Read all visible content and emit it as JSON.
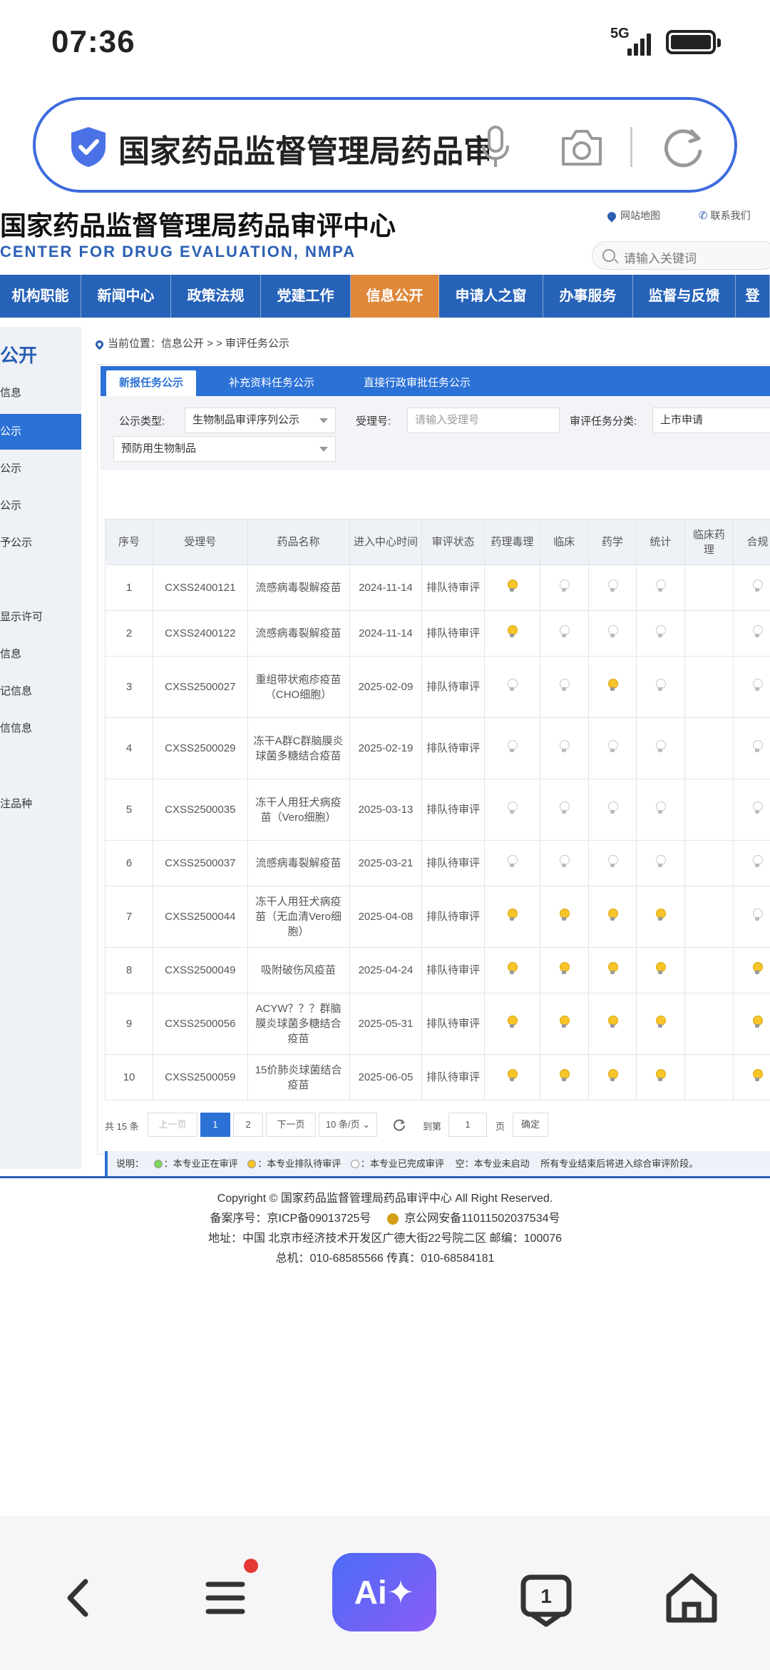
{
  "status": {
    "time": "07:36",
    "network": "5G"
  },
  "browser": {
    "search_text": "国家药品监督管理局药品审评中心"
  },
  "site": {
    "title_cn": "国家药品监督管理局药品审评中心",
    "title_en": "CENTER FOR DRUG EVALUATION, NMPA",
    "link_sitemap": "网站地图",
    "link_contact": "联系我们",
    "search_placeholder": "请输入关键词",
    "nav": [
      "机构职能",
      "新闻中心",
      "政策法规",
      "党建工作",
      "信息公开",
      "申请人之窗",
      "办事服务",
      "监督与反馈",
      "登"
    ],
    "nav_active": "信息公开"
  },
  "sidebar": {
    "title": "公开",
    "items": [
      "信息",
      "公示",
      "公示",
      "公示",
      "予公示",
      "显示许可",
      "信息",
      "记信息",
      "信信息",
      "注品种"
    ]
  },
  "breadcrumb": "当前位置：信息公开 > > 审评任务公示",
  "tabs": [
    "新报任务公示",
    "补充资料任务公示",
    "直接行政审批任务公示"
  ],
  "filters": {
    "type_label": "公示类型:",
    "type_value": "生物制品审评序列公示",
    "subtype_value": "预防用生物制品",
    "accept_label": "受理号:",
    "accept_placeholder": "请输入受理号",
    "task_label": "审评任务分类:",
    "task_value": "上市申请"
  },
  "table": {
    "headers": [
      "序号",
      "受理号",
      "药品名称",
      "进入中心时间",
      "审评状态",
      "药理毒理",
      "临床",
      "药学",
      "统计",
      "临床药理",
      "合规"
    ],
    "rows": [
      {
        "no": "1",
        "id": "CXSS2400121",
        "name": "流感病毒裂解疫苗",
        "date": "2024-11-14",
        "status": "排队待审评",
        "b": [
          "wait",
          "done",
          "done",
          "done",
          "",
          "done"
        ]
      },
      {
        "no": "2",
        "id": "CXSS2400122",
        "name": "流感病毒裂解疫苗",
        "date": "2024-11-14",
        "status": "排队待审评",
        "b": [
          "wait",
          "done",
          "done",
          "done",
          "",
          "done"
        ]
      },
      {
        "no": "3",
        "id": "CXSS2500027",
        "name": "重组带状疱疹疫苗（CHO细胞）",
        "date": "2025-02-09",
        "status": "排队待审评",
        "b": [
          "done",
          "done",
          "wait",
          "done",
          "",
          "done"
        ]
      },
      {
        "no": "4",
        "id": "CXSS2500029",
        "name": "冻干A群C群脑膜炎球菌多糖结合疫苗",
        "date": "2025-02-19",
        "status": "排队待审评",
        "b": [
          "done",
          "done",
          "done",
          "done",
          "",
          "done"
        ]
      },
      {
        "no": "5",
        "id": "CXSS2500035",
        "name": "冻干人用狂犬病疫苗（Vero细胞）",
        "date": "2025-03-13",
        "status": "排队待审评",
        "b": [
          "done",
          "done",
          "done",
          "done",
          "",
          "done"
        ]
      },
      {
        "no": "6",
        "id": "CXSS2500037",
        "name": "流感病毒裂解疫苗",
        "date": "2025-03-21",
        "status": "排队待审评",
        "b": [
          "done",
          "done",
          "done",
          "done",
          "",
          "done"
        ]
      },
      {
        "no": "7",
        "id": "CXSS2500044",
        "name": "冻干人用狂犬病疫苗（无血清Vero细胞）",
        "date": "2025-04-08",
        "status": "排队待审评",
        "b": [
          "wait",
          "wait",
          "wait",
          "wait",
          "",
          "done"
        ]
      },
      {
        "no": "8",
        "id": "CXSS2500049",
        "name": "吸附破伤风疫苗",
        "date": "2025-04-24",
        "status": "排队待审评",
        "b": [
          "wait",
          "wait",
          "wait",
          "wait",
          "",
          "wait"
        ]
      },
      {
        "no": "9",
        "id": "CXSS2500056",
        "name": "ACYW？？？群脑膜炎球菌多糖结合疫苗",
        "date": "2025-05-31",
        "status": "排队待审评",
        "b": [
          "wait",
          "wait",
          "wait",
          "wait",
          "",
          "wait"
        ]
      },
      {
        "no": "10",
        "id": "CXSS2500059",
        "name": "15价肺炎球菌结合疫苗",
        "date": "2025-06-05",
        "status": "排队待审评",
        "b": [
          "wait",
          "wait",
          "wait",
          "wait",
          "",
          "wait"
        ]
      }
    ]
  },
  "pager": {
    "total": "共 15 条",
    "prev": "上一页",
    "page1": "1",
    "page2": "2",
    "next": "下一页",
    "size": "10 条/页",
    "goto": "到第",
    "page_input": "1",
    "page_unit": "页",
    "confirm": "确定"
  },
  "legend": {
    "label": "说明：",
    "in_review": "：本专业正在审评",
    "waiting": "：本专业排队待审评",
    "done": "：本专业已完成审评",
    "empty": "空：本专业未启动",
    "note": "所有专业结束后将进入综合审评阶段。"
  },
  "footer": {
    "copyright": "Copyright © 国家药品监督管理局药品审评中心   All Right Reserved.",
    "icp": "备案序号：京ICP备09013725号",
    "police": "京公网安备11011502037534号",
    "address": "地址：中国 北京市经济技术开发区广德大街22号院二区     邮编：100076",
    "phone": "总机：010-68585566     传真：010-68584181"
  },
  "colors": {
    "brand": "#2662b8",
    "nav_active": "#e0883a",
    "tab": "#2b71d6",
    "wait_bulb": "#f7c52a"
  }
}
